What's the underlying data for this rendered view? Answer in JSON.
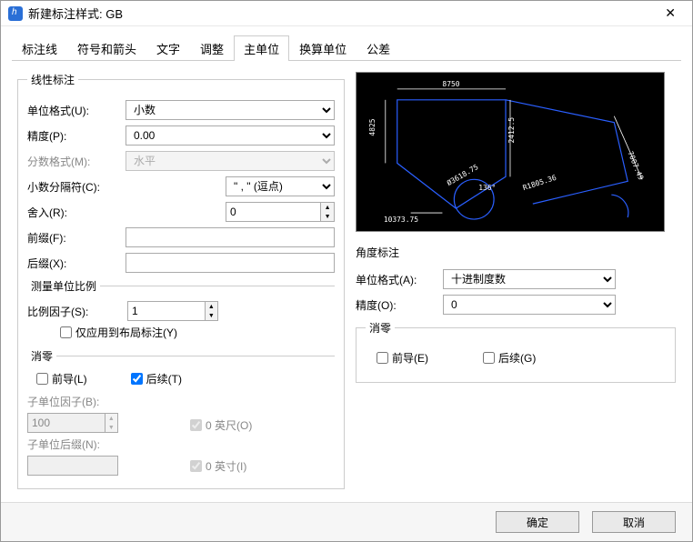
{
  "window": {
    "title": "新建标注样式: GB"
  },
  "tabs": [
    "标注线",
    "符号和箭头",
    "文字",
    "调整",
    "主单位",
    "换算单位",
    "公差"
  ],
  "active_tab": "主单位",
  "linear": {
    "legend": "线性标注",
    "unit_format_label": "单位格式(U):",
    "unit_format_value": "小数",
    "precision_label": "精度(P):",
    "precision_value": "0.00",
    "fraction_format_label": "分数格式(M):",
    "fraction_format_value": "水平",
    "decimal_sep_label": "小数分隔符(C):",
    "decimal_sep_value": "\" , \" (逗点)",
    "round_label": "舍入(R):",
    "round_value": "0",
    "prefix_label": "前缀(F):",
    "prefix_value": "",
    "suffix_label": "后缀(X):",
    "suffix_value": "",
    "scale_legend": "测量单位比例",
    "scale_factor_label": "比例因子(S):",
    "scale_factor_value": "1",
    "layout_only_label": "仅应用到布局标注(Y)",
    "zero_legend": "消零",
    "leading_label": "前导(L)",
    "trailing_label": "后续(T)",
    "subunit_factor_label": "子单位因子(B):",
    "subunit_factor_value": "100",
    "subunit_suffix_label": "子单位后缀(N):",
    "subunit_suffix_value": "",
    "feet_label": "0 英尺(O)",
    "inches_label": "0 英寸(I)"
  },
  "angle": {
    "heading": "角度标注",
    "unit_format_label": "单位格式(A):",
    "unit_format_value": "十进制度数",
    "precision_label": "精度(O):",
    "precision_value": "0",
    "zero_legend": "消零",
    "leading_label": "前导(E)",
    "trailing_label": "后续(G)"
  },
  "preview": {
    "dim_top": "8750",
    "dim_left": "4825",
    "dim_mid": "2412.5",
    "dim_r": "R1805.36",
    "dim_len": "10373.75",
    "dim_diag": "7007.49",
    "dim_ang1": "Ø3618.75",
    "dim_ang2": "136°"
  },
  "buttons": {
    "ok": "确定",
    "cancel": "取消"
  }
}
